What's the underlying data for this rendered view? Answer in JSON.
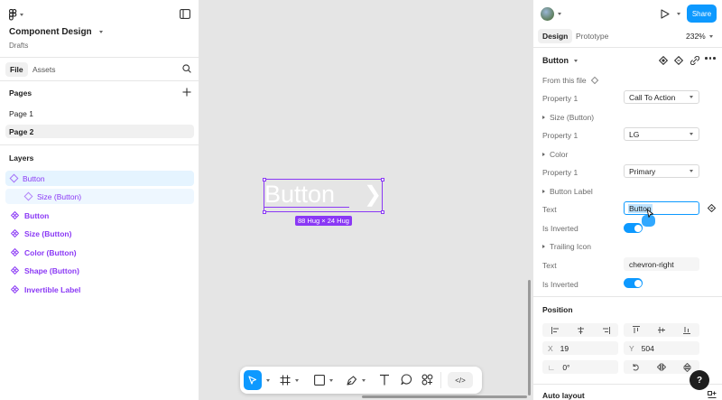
{
  "left_panel": {
    "file_title": "Component Design",
    "location": "Drafts",
    "tabs": [
      "File",
      "Assets"
    ],
    "pages_heading": "Pages",
    "pages": [
      "Page 1",
      "Page 2"
    ],
    "layers_heading": "Layers",
    "layers": [
      "Button",
      "Size (Button)",
      "Button",
      "Size (Button)",
      "Color (Button)",
      "Shape (Button)",
      "Invertible Label"
    ]
  },
  "canvas": {
    "button_text": "Button",
    "button_glyph": "❯",
    "size_badge": "88 Hug × 24 Hug"
  },
  "right_panel": {
    "share_label": "Share",
    "tabs": [
      "Design",
      "Prototype"
    ],
    "zoom": "232%",
    "instance_name": "Button",
    "from_this_file": "From this file",
    "props": {
      "property1_label": "Property 1",
      "property1_value": "Call To Action",
      "size_section": "Size (Button)",
      "size_prop_label": "Property 1",
      "size_value": "LG",
      "color_section": "Color",
      "color_prop_label": "Property 1",
      "color_value": "Primary",
      "label_section": "Button Label",
      "text_label": "Text",
      "text_value": "Button",
      "inverted_label": "Is Inverted",
      "trailing_section": "Trailing Icon",
      "icon_text_label": "Text",
      "icon_text_value": "chevron-right",
      "icon_inverted_label": "Is Inverted"
    },
    "position": {
      "heading": "Position",
      "x_label": "X",
      "x_value": "19",
      "y_label": "Y",
      "y_value": "504",
      "rotation_icon": "∟",
      "rotation_value": "0°"
    },
    "auto_layout_heading": "Auto layout"
  },
  "toolbar": {
    "code_label": "</>"
  },
  "help_label": "?",
  "colors": {
    "accent": "#0d99ff",
    "component": "#8a38f5",
    "selection_bg": "#e5f4ff"
  }
}
